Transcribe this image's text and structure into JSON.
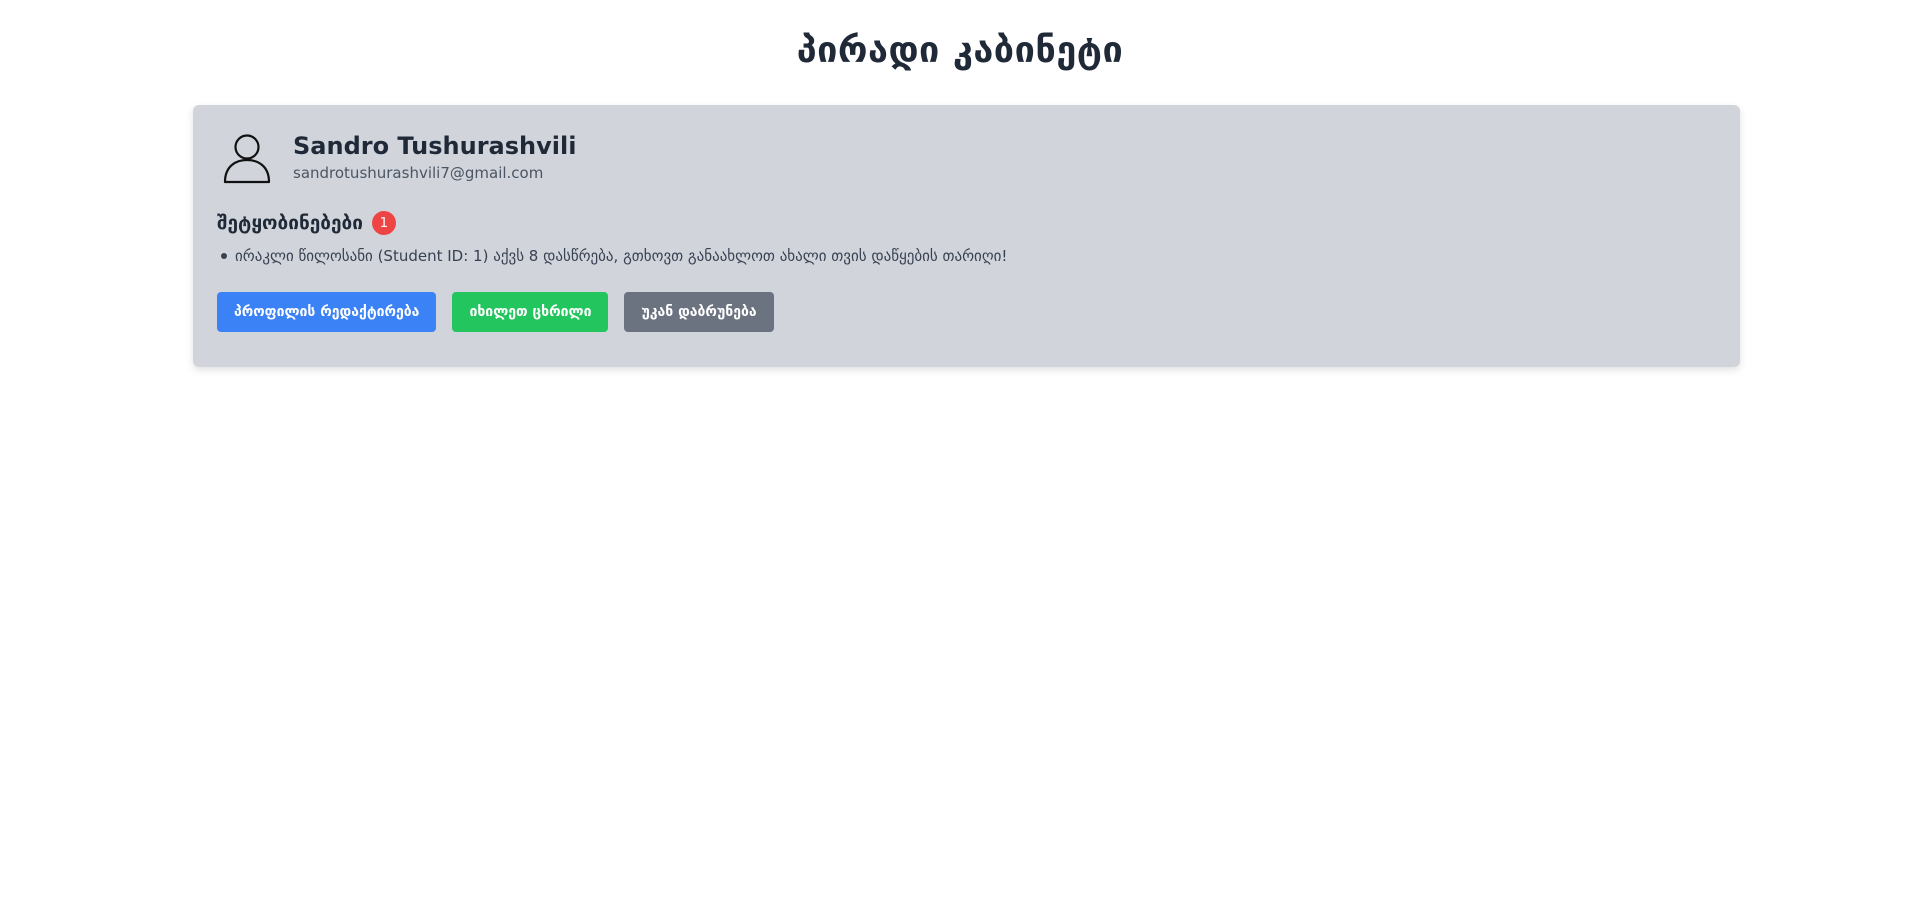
{
  "page": {
    "title": "პირადი კაბინეტი"
  },
  "profile": {
    "avatar_icon": "user-outline-icon",
    "name": "Sandro Tushurashvili",
    "email": "sandrotushurashvili7@gmail.com"
  },
  "notifications": {
    "title": "შეტყობინებები",
    "count": "1",
    "items": [
      "ირაკლი წილოსანი (Student ID: 1) აქვს 8 დასწრება, გთხოვთ განაახლოთ ახალი თვის დაწყების თარიღი!"
    ]
  },
  "actions": {
    "edit_profile_label": "პროფილის რედაქტირება",
    "view_table_label": "იხილეთ ცხრილი",
    "back_label": "უკან დაბრუნება"
  },
  "colors": {
    "card_bg": "#d1d5db",
    "primary": "#3b82f6",
    "success": "#22c55e",
    "secondary": "#6b7280",
    "badge": "#ef4444"
  }
}
